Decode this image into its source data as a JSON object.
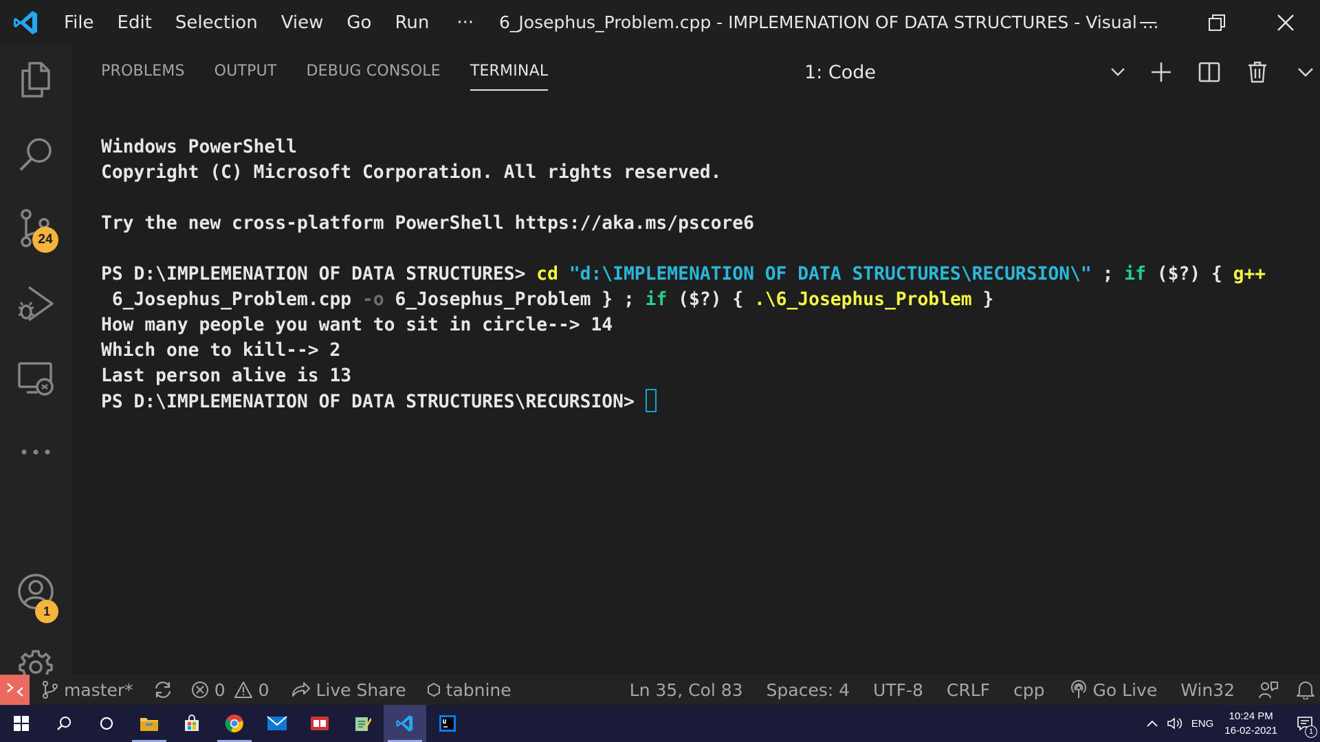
{
  "window": {
    "title": "6_Josephus_Problem.cpp - IMPLEMENATION OF DATA STRUCTURES - Visual ...",
    "menu": [
      "File",
      "Edit",
      "Selection",
      "View",
      "Go",
      "Run",
      "···"
    ]
  },
  "activity_bar": {
    "items": [
      {
        "name": "explorer-icon"
      },
      {
        "name": "search-icon"
      },
      {
        "name": "source-control-icon",
        "badge": "24"
      },
      {
        "name": "run-debug-icon"
      },
      {
        "name": "remote-explorer-icon"
      },
      {
        "name": "more-icon"
      },
      {
        "name": "accounts-icon",
        "badge": "1"
      },
      {
        "name": "settings-gear-icon"
      }
    ]
  },
  "panel": {
    "tabs": [
      "PROBLEMS",
      "OUTPUT",
      "DEBUG CONSOLE",
      "TERMINAL"
    ],
    "active_tab": "TERMINAL",
    "terminal_select": "1: Code"
  },
  "terminal": {
    "lines": {
      "l1": "Windows PowerShell",
      "l2": "Copyright (C) Microsoft Corporation. All rights reserved.",
      "l3": "Try the new cross-platform PowerShell https://aka.ms/pscore6",
      "prompt1": "PS D:\\IMPLEMENATION OF DATA STRUCTURES> ",
      "cmd_cd": "cd",
      "cmd_path": "\"d:\\IMPLEMENATION OF DATA STRUCTURES\\RECURSION\\\"",
      "cmd_sep1": " ; ",
      "cmd_if1": "if",
      "cmd_cond1": " ($?) ",
      "cmd_brace_open1": "{ ",
      "cmd_gpp": "g++",
      "cmd_src": " 6_Josephus_Problem.cpp ",
      "cmd_o": "-o",
      "cmd_out": " 6_Josephus_Problem } ; ",
      "cmd_if2": "if",
      "cmd_cond2": " ($?) ",
      "cmd_brace_open2": "{ ",
      "cmd_run": ".\\6_Josephus_Problem",
      "cmd_brace_close2": " }",
      "out1": "How many people you want to sit in circle--> 14",
      "out2": "Which one to kill--> 2",
      "out3": "Last person alive is 13",
      "prompt2": "PS D:\\IMPLEMENATION OF DATA STRUCTURES\\RECURSION> "
    }
  },
  "status_bar": {
    "branch": "master*",
    "errors": "0",
    "warnings": "0",
    "live_share": "Live Share",
    "tabnine": "tabnine",
    "position": "Ln 35, Col 83",
    "spaces": "Spaces: 4",
    "encoding": "UTF-8",
    "eol": "CRLF",
    "language": "cpp",
    "go_live": "Go Live",
    "platform": "Win32"
  },
  "taskbar": {
    "apps": [
      "start-icon",
      "search-icon",
      "task-view-icon",
      "file-explorer-icon",
      "store-icon",
      "chrome-icon",
      "mail-icon",
      "app-red-icon",
      "notepad-icon",
      "vscode-icon",
      "intellij-icon"
    ],
    "language": "ENG",
    "time": "10:24 PM",
    "date": "16-02-2021",
    "notifications": "1"
  },
  "colors": {
    "accent_badge": "#f4b43d",
    "remote_indicator": "#e96b5f",
    "terminal_yellow": "#f5f543",
    "terminal_cyan": "#29b8db",
    "terminal_green": "#23d18b",
    "vscode_blue": "#23a9f2"
  }
}
